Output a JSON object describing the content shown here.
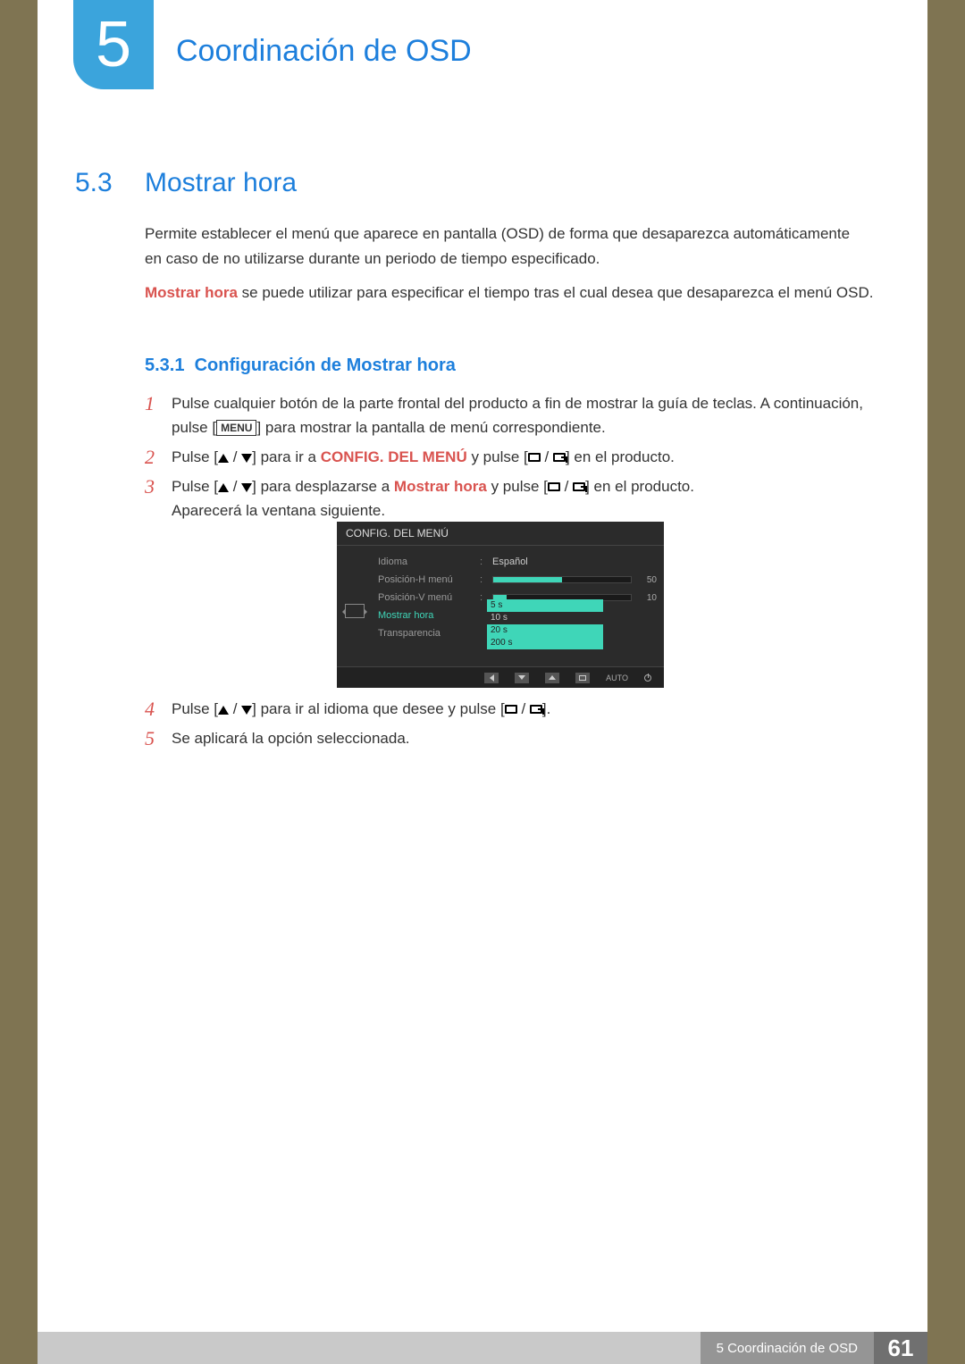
{
  "chapter": {
    "number": "5",
    "title": "Coordinación de OSD"
  },
  "section": {
    "number": "5.3",
    "title": "Mostrar hora"
  },
  "intro": {
    "p1": "Permite establecer el menú que aparece en pantalla (OSD) de forma que desaparezca automáticamente en caso de no utilizarse durante un periodo de tiempo especificado.",
    "p2_highlight": "Mostrar hora",
    "p2_rest": " se puede utilizar para especificar el tiempo tras el cual desea que desaparezca el menú OSD."
  },
  "subsection": {
    "number": "5.3.1",
    "title": "Configuración de Mostrar hora"
  },
  "steps": {
    "s1a": "Pulse cualquier botón de la parte frontal del producto a fin de mostrar la guía de teclas. A continuación, pulse [",
    "s1_menu": "MENU",
    "s1b": "] para mostrar la pantalla de menú correspondiente.",
    "s2a": "Pulse [",
    "s2b": "] para ir a ",
    "s2_hl": "CONFIG. DEL MENÚ",
    "s2c": " y pulse [",
    "s2d": "] en el producto.",
    "s3a": "Pulse [",
    "s3b": "] para desplazarse a ",
    "s3_hl": "Mostrar hora",
    "s3c": " y pulse [",
    "s3d": "] en el producto.",
    "s3e": "Aparecerá la ventana siguiente.",
    "s4a": "Pulse [",
    "s4b": "] para ir al idioma que desee y pulse [",
    "s4c": "].",
    "s5": "Se aplicará la opción seleccionada."
  },
  "step_numbers": {
    "n1": "1",
    "n2": "2",
    "n3": "3",
    "n4": "4",
    "n5": "5"
  },
  "osd": {
    "header": "CONFIG. DEL MENÚ",
    "rows": {
      "idioma": "Idioma",
      "posh": "Posición-H menú",
      "posv": "Posición-V menú",
      "mostrar": "Mostrar hora",
      "trans": "Transparencia"
    },
    "values": {
      "idioma": "Español",
      "posh": "50",
      "posv": "10"
    },
    "options": {
      "o1": "5 s",
      "o2": "10 s",
      "o3": "20 s",
      "o4": "200 s"
    },
    "footer_auto": "AUTO"
  },
  "footer": {
    "breadcrumb": "5 Coordinación de OSD",
    "page": "61"
  }
}
